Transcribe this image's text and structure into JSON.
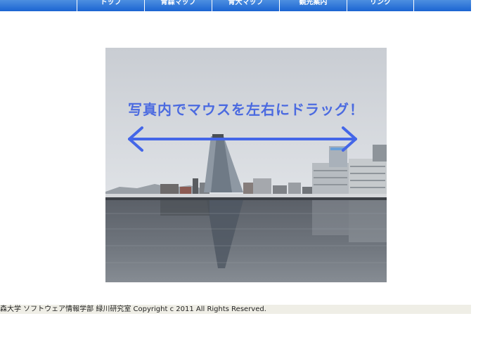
{
  "nav": {
    "items": [
      {
        "label": "トップ"
      },
      {
        "label": "青森マップ"
      },
      {
        "label": "青大マップ"
      },
      {
        "label": "観光案内"
      },
      {
        "label": "リンク"
      }
    ]
  },
  "photo": {
    "drag_hint": "写真内でマウスを左右にドラッグ！"
  },
  "footer": {
    "text": "森大学 ソフトウェア情報学部 緑川研究室 Copyright c 2011 All Rights Reserved."
  },
  "colors": {
    "nav_bar": "#1b64d2",
    "hint_text": "#4b6ae0",
    "arrow": "#4466e8",
    "footer_bg": "#efeee6"
  }
}
